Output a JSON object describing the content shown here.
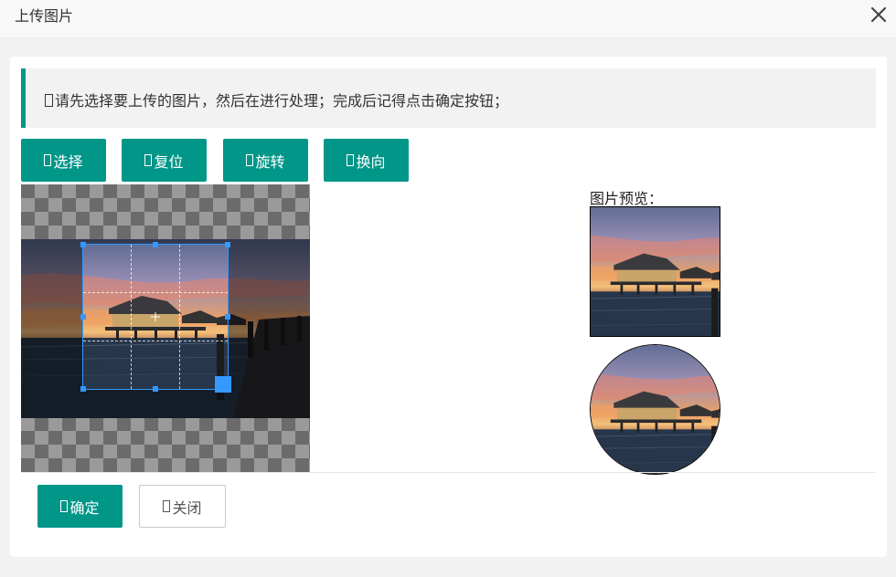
{
  "dialog": {
    "title": "上传图片",
    "close_icon": "close-icon"
  },
  "notice": {
    "icon": "info-icon",
    "text": "请先选择要上传的图片，然后在进行处理；完成后记得点击确定按钮；",
    "accent_color": "#009688"
  },
  "toolbar": {
    "select_label": "选择",
    "reset_label": "复位",
    "rotate_label": "旋转",
    "flip_label": "换向"
  },
  "preview": {
    "label": "图片预览："
  },
  "footer": {
    "confirm_label": "确定",
    "close_label": "关闭"
  },
  "colors": {
    "primary": "#009688",
    "crop_handle": "#3399ff"
  }
}
